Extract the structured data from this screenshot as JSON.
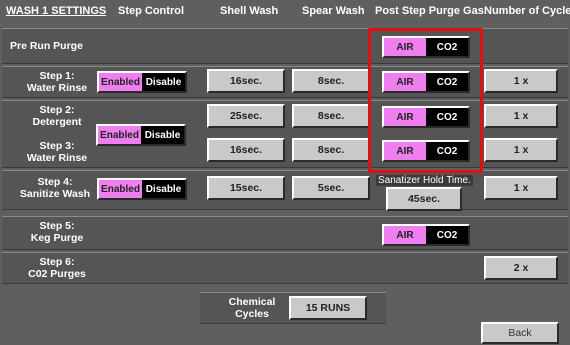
{
  "header": {
    "title": "WASH 1 SETTINGS",
    "col_step_control": "Step Control",
    "col_shell_wash": "Shell Wash",
    "col_spear_wash": "Spear Wash",
    "col_purge_gas": "Post Step Purge Gas",
    "col_cycles": "Number of Cycles"
  },
  "toggles": {
    "enabled": "Enabled",
    "disable": "Disable",
    "air": "AIR",
    "co2": "CO2"
  },
  "rows": {
    "pre_run": {
      "label": "Pre Run Purge"
    },
    "step1": {
      "label_a": "Step 1:",
      "label_b": "Water Rinse",
      "shell": "16sec.",
      "spear": "8sec.",
      "cycles": "1 x"
    },
    "step2": {
      "label_a": "Step 2:",
      "label_b": "Detergent",
      "shell": "25sec.",
      "spear": "8sec.",
      "cycles": "1 x"
    },
    "step3": {
      "label_a": "Step 3:",
      "label_b": "Water Rinse",
      "shell": "16sec.",
      "spear": "8sec.",
      "cycles": "1 x"
    },
    "step4": {
      "label_a": "Step 4:",
      "label_b": "Sanitize Wash",
      "shell": "15sec.",
      "spear": "5sec.",
      "hold_label": "Sanatizer Hold Time.",
      "hold_value": "45sec.",
      "cycles": "1 x"
    },
    "step5": {
      "label_a": "Step 5:",
      "label_b": "Keg Purge"
    },
    "step6": {
      "label_a": "Step 6:",
      "label_b": "C02 Purges",
      "cycles": "2 x"
    }
  },
  "chemical": {
    "label_a": "Chemical",
    "label_b": "Cycles",
    "value": "15 RUNS"
  },
  "back_label": "Back",
  "colors": {
    "toggle_on": "#ef7fef",
    "highlight": "#e01010",
    "panel": "#5f5f5f"
  }
}
